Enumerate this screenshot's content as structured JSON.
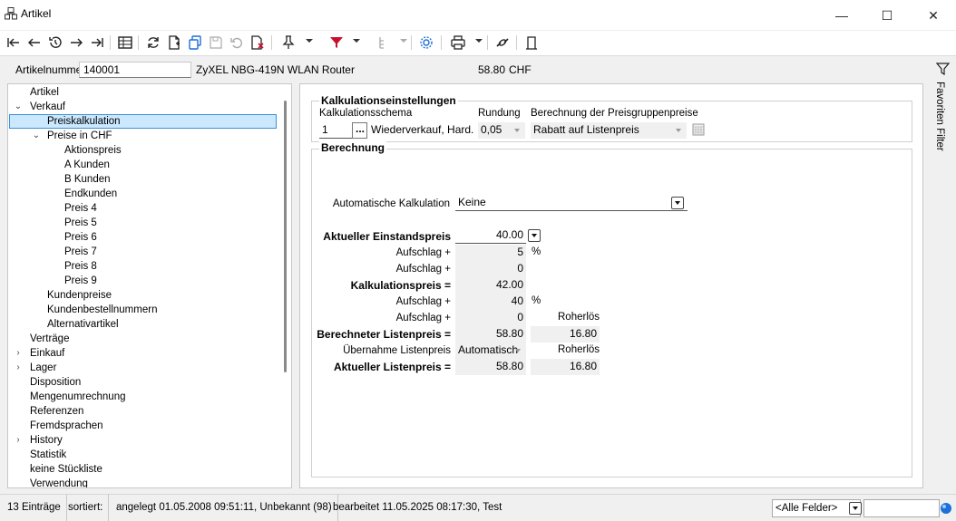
{
  "window": {
    "title": "Artikel",
    "minimize": "—",
    "maximize": "☐",
    "close": "✕"
  },
  "header": {
    "artnr_label": "Artikelnummer",
    "artnr_value": "140001",
    "description": "ZyXEL NBG-419N WLAN Router",
    "price": "58.80",
    "currency": "CHF"
  },
  "tree": {
    "items": [
      "Artikel",
      "Verkauf",
      "Preiskalkulation",
      "Preise in CHF",
      "Aktionspreis",
      "A Kunden",
      "B Kunden",
      "Endkunden",
      "Preis 4",
      "Preis 5",
      "Preis 6",
      "Preis 7",
      "Preis 8",
      "Preis 9",
      "Kundenpreise",
      "Kundenbestellnummern",
      "Alternativartikel",
      "Verträge",
      "Einkauf",
      "Lager",
      "Disposition",
      "Mengenumrechnung",
      "Referenzen",
      "Fremdsprachen",
      "History",
      "Statistik",
      "keine Stückliste",
      "Verwendung"
    ],
    "selected": "Preiskalkulation"
  },
  "settings": {
    "title": "Kalkulationseinstellungen",
    "schema_label": "Kalkulationsschema",
    "schema_value": "1",
    "schema_button": "...",
    "schema_name": "Wiederverkauf, Hard...",
    "rounding_label": "Rundung",
    "rounding_value": "0,05",
    "pricegroup_label": "Berechnung der Preisgruppenpreise",
    "pricegroup_value": "Rabatt auf Listenpreis"
  },
  "calc": {
    "title": "Berechnung",
    "auto_label": "Automatische Kalkulation",
    "auto_value": "Keine",
    "einstand_label": "Aktueller Einstandspreis",
    "einstand_value": "40.00",
    "aufschlag1_label": "Aufschlag +",
    "aufschlag1_value": "5",
    "aufschlag1_unit": "%",
    "aufschlag2_label": "Aufschlag +",
    "aufschlag2_value": "0",
    "kalkpreis_label": "Kalkulationspreis =",
    "kalkpreis_value": "42.00",
    "aufschlag3_label": "Aufschlag +",
    "aufschlag3_value": "40",
    "aufschlag3_unit": "%",
    "aufschlag4_label": "Aufschlag +",
    "aufschlag4_value": "0",
    "roherloes1_label": "Roherlös",
    "berechnet_label": "Berechneter Listenpreis =",
    "berechnet_value": "58.80",
    "berechnet_roherloes": "16.80",
    "uebernahme_label": "Übernahme Listenpreis",
    "uebernahme_value": "Automatisch",
    "roherloes2_label": "Roherlös",
    "aktuell_label": "Aktueller Listenpreis =",
    "aktuell_value": "58.80",
    "aktuell_roherloes": "16.80"
  },
  "sidebar": {
    "label": "Favoriten Filter"
  },
  "status": {
    "count": "13 Einträge",
    "sorted": "sortiert:",
    "created": "angelegt 01.05.2008 09:51:11, Unbekannt (98)",
    "edited": "bearbeitet 11.05.2025 08:17:30, Test",
    "filter": "<Alle Felder>"
  },
  "colors": {
    "selection": "#cce8ff",
    "selection_border": "#3c8fd6",
    "filter_red": "#c8102e",
    "accent_blue": "#1e6fd9"
  }
}
